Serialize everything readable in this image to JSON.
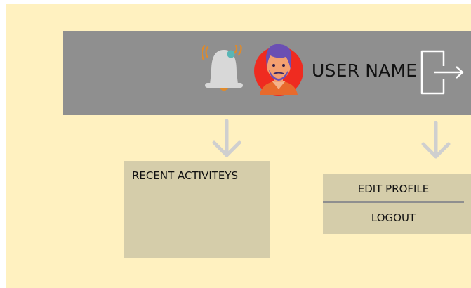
{
  "header": {
    "user_name": "USER NAME",
    "icons": {
      "notification": "bell-icon",
      "avatar": "user-avatar",
      "logout": "logout-icon"
    }
  },
  "recent_panel": {
    "title": "RECENT ACTIVITEYS"
  },
  "profile_menu": {
    "items": [
      "EDIT PROFILE",
      "LOGOUT"
    ]
  },
  "colors": {
    "canvas_background": "#fff1c0",
    "header_bar": "#8f8f8f",
    "panel": "#d5cdaa",
    "arrow": "#cfcfcf",
    "avatar_ring": "#ef2b20"
  }
}
